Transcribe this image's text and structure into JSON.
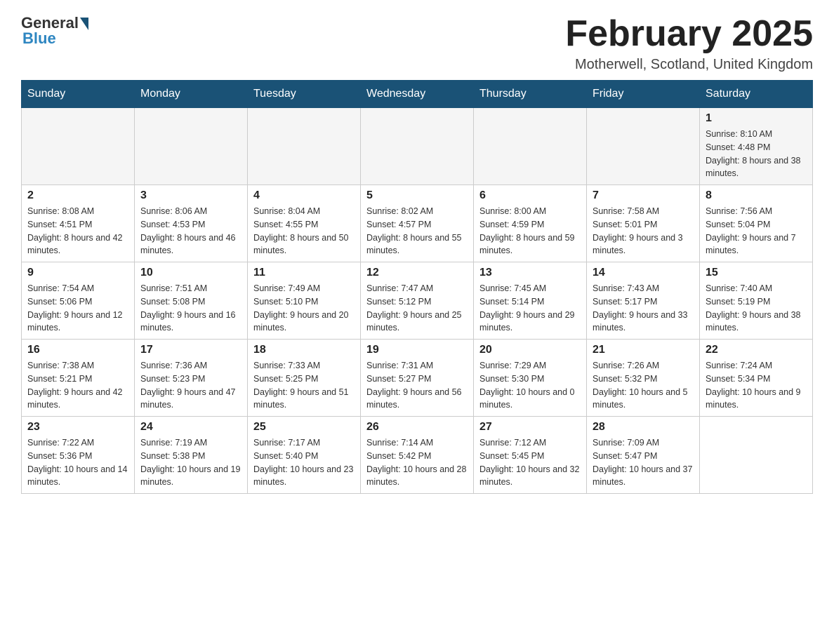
{
  "header": {
    "logo": {
      "general": "General",
      "blue": "Blue"
    },
    "title": "February 2025",
    "location": "Motherwell, Scotland, United Kingdom"
  },
  "days_of_week": [
    "Sunday",
    "Monday",
    "Tuesday",
    "Wednesday",
    "Thursday",
    "Friday",
    "Saturday"
  ],
  "weeks": [
    {
      "days": [
        {
          "number": "",
          "info": ""
        },
        {
          "number": "",
          "info": ""
        },
        {
          "number": "",
          "info": ""
        },
        {
          "number": "",
          "info": ""
        },
        {
          "number": "",
          "info": ""
        },
        {
          "number": "",
          "info": ""
        },
        {
          "number": "1",
          "info": "Sunrise: 8:10 AM\nSunset: 4:48 PM\nDaylight: 8 hours and 38 minutes."
        }
      ]
    },
    {
      "days": [
        {
          "number": "2",
          "info": "Sunrise: 8:08 AM\nSunset: 4:51 PM\nDaylight: 8 hours and 42 minutes."
        },
        {
          "number": "3",
          "info": "Sunrise: 8:06 AM\nSunset: 4:53 PM\nDaylight: 8 hours and 46 minutes."
        },
        {
          "number": "4",
          "info": "Sunrise: 8:04 AM\nSunset: 4:55 PM\nDaylight: 8 hours and 50 minutes."
        },
        {
          "number": "5",
          "info": "Sunrise: 8:02 AM\nSunset: 4:57 PM\nDaylight: 8 hours and 55 minutes."
        },
        {
          "number": "6",
          "info": "Sunrise: 8:00 AM\nSunset: 4:59 PM\nDaylight: 8 hours and 59 minutes."
        },
        {
          "number": "7",
          "info": "Sunrise: 7:58 AM\nSunset: 5:01 PM\nDaylight: 9 hours and 3 minutes."
        },
        {
          "number": "8",
          "info": "Sunrise: 7:56 AM\nSunset: 5:04 PM\nDaylight: 9 hours and 7 minutes."
        }
      ]
    },
    {
      "days": [
        {
          "number": "9",
          "info": "Sunrise: 7:54 AM\nSunset: 5:06 PM\nDaylight: 9 hours and 12 minutes."
        },
        {
          "number": "10",
          "info": "Sunrise: 7:51 AM\nSunset: 5:08 PM\nDaylight: 9 hours and 16 minutes."
        },
        {
          "number": "11",
          "info": "Sunrise: 7:49 AM\nSunset: 5:10 PM\nDaylight: 9 hours and 20 minutes."
        },
        {
          "number": "12",
          "info": "Sunrise: 7:47 AM\nSunset: 5:12 PM\nDaylight: 9 hours and 25 minutes."
        },
        {
          "number": "13",
          "info": "Sunrise: 7:45 AM\nSunset: 5:14 PM\nDaylight: 9 hours and 29 minutes."
        },
        {
          "number": "14",
          "info": "Sunrise: 7:43 AM\nSunset: 5:17 PM\nDaylight: 9 hours and 33 minutes."
        },
        {
          "number": "15",
          "info": "Sunrise: 7:40 AM\nSunset: 5:19 PM\nDaylight: 9 hours and 38 minutes."
        }
      ]
    },
    {
      "days": [
        {
          "number": "16",
          "info": "Sunrise: 7:38 AM\nSunset: 5:21 PM\nDaylight: 9 hours and 42 minutes."
        },
        {
          "number": "17",
          "info": "Sunrise: 7:36 AM\nSunset: 5:23 PM\nDaylight: 9 hours and 47 minutes."
        },
        {
          "number": "18",
          "info": "Sunrise: 7:33 AM\nSunset: 5:25 PM\nDaylight: 9 hours and 51 minutes."
        },
        {
          "number": "19",
          "info": "Sunrise: 7:31 AM\nSunset: 5:27 PM\nDaylight: 9 hours and 56 minutes."
        },
        {
          "number": "20",
          "info": "Sunrise: 7:29 AM\nSunset: 5:30 PM\nDaylight: 10 hours and 0 minutes."
        },
        {
          "number": "21",
          "info": "Sunrise: 7:26 AM\nSunset: 5:32 PM\nDaylight: 10 hours and 5 minutes."
        },
        {
          "number": "22",
          "info": "Sunrise: 7:24 AM\nSunset: 5:34 PM\nDaylight: 10 hours and 9 minutes."
        }
      ]
    },
    {
      "days": [
        {
          "number": "23",
          "info": "Sunrise: 7:22 AM\nSunset: 5:36 PM\nDaylight: 10 hours and 14 minutes."
        },
        {
          "number": "24",
          "info": "Sunrise: 7:19 AM\nSunset: 5:38 PM\nDaylight: 10 hours and 19 minutes."
        },
        {
          "number": "25",
          "info": "Sunrise: 7:17 AM\nSunset: 5:40 PM\nDaylight: 10 hours and 23 minutes."
        },
        {
          "number": "26",
          "info": "Sunrise: 7:14 AM\nSunset: 5:42 PM\nDaylight: 10 hours and 28 minutes."
        },
        {
          "number": "27",
          "info": "Sunrise: 7:12 AM\nSunset: 5:45 PM\nDaylight: 10 hours and 32 minutes."
        },
        {
          "number": "28",
          "info": "Sunrise: 7:09 AM\nSunset: 5:47 PM\nDaylight: 10 hours and 37 minutes."
        },
        {
          "number": "",
          "info": ""
        }
      ]
    }
  ]
}
